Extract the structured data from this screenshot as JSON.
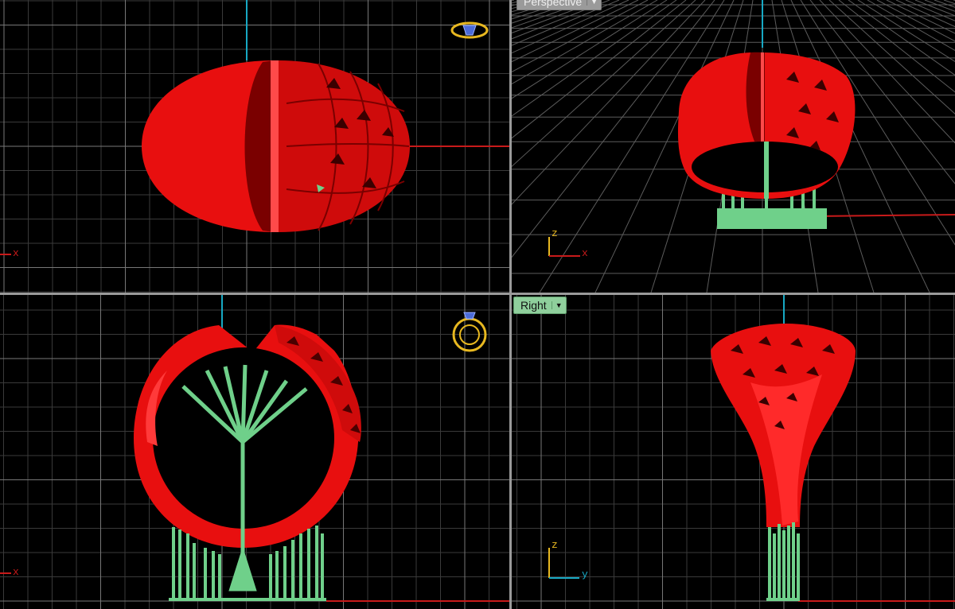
{
  "viewports": {
    "perspective": {
      "label": "Perspective"
    },
    "right": {
      "label": "Right"
    }
  },
  "axes": {
    "top_x": "x",
    "persp_z": "z",
    "persp_x": "x",
    "front_x": "x",
    "right_z": "z",
    "right_y": "y"
  },
  "icons": {
    "viewport_menu": "chevron-down-icon",
    "ring_view_top": "ring-gizmo-icon",
    "ring_view_front": "ring-gizmo-icon"
  },
  "colors": {
    "background": "#000000",
    "grid_minor": "#3a3a3a",
    "grid_major": "#7a7a7a",
    "ring_red": "#e80f0f",
    "support_green": "#6fd08a",
    "axis_red": "#c81a1a",
    "axis_cyan": "#17a9c4",
    "label_bg": "#8fcf9c"
  }
}
